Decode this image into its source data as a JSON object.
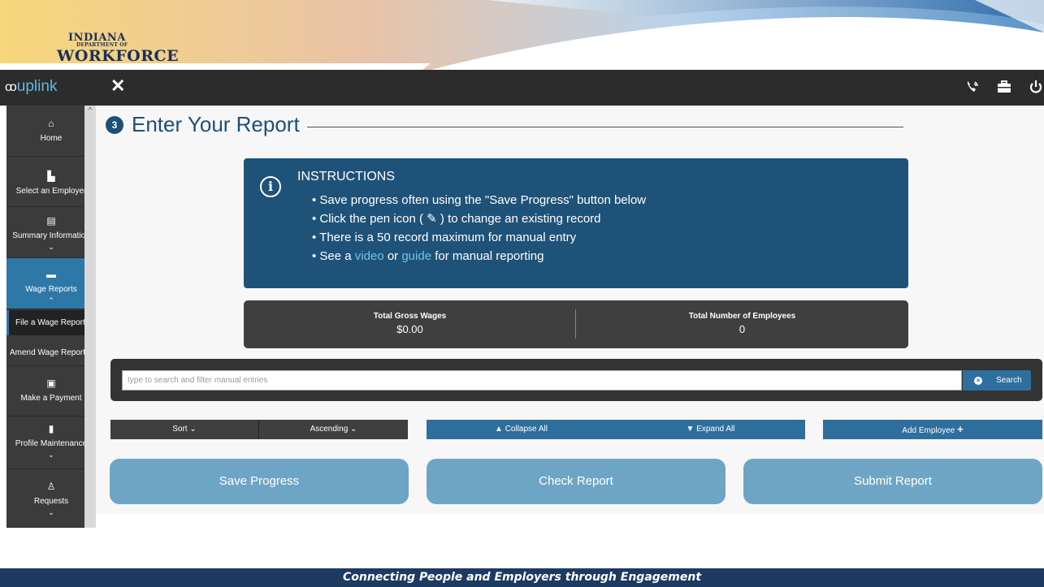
{
  "banner": {
    "logo_line1": "INDIANA",
    "logo_line2": "DEPARTMENT OF",
    "logo_line3": "WORKFORCE"
  },
  "topbar": {
    "brand_prefix": "uplink",
    "brand_icon": "oo",
    "close_icon": "close-icon",
    "icons": [
      "phone-ringing-icon",
      "briefcase-icon",
      "power-icon"
    ]
  },
  "sidebar": {
    "items": [
      {
        "label": "Home",
        "icon": "home-icon"
      },
      {
        "label": "Select an Employer",
        "icon": "building-icon"
      },
      {
        "label": "Summary Information",
        "icon": "document-icon"
      },
      {
        "label": "Wage Reports",
        "icon": "folder-icon"
      },
      {
        "label": "Make a Payment",
        "icon": "money-icon"
      },
      {
        "label": "Profile Maintenance",
        "icon": "file-icon"
      },
      {
        "label": "Requests",
        "icon": "user-icon"
      }
    ],
    "subitems": [
      "File a Wage Report",
      "Amend Wage Report"
    ]
  },
  "main": {
    "step_number": "3",
    "title": "Enter Your Report",
    "instructions": {
      "title": "INSTRUCTIONS",
      "line1": "Save progress often using the \"Save Progress\" button below",
      "line2_a": "Click the pen icon (",
      "line2_b": ") to change an existing record",
      "line3": "There is a 50 record maximum for manual entry",
      "line4_a": "See a",
      "line4_video": "video",
      "line4_or": "or",
      "line4_guide": "guide",
      "line4_b": "for manual reporting"
    },
    "totals": {
      "gross_label": "Total Gross Wages",
      "gross_value": "$0.00",
      "employees_label": "Total Number of Employees",
      "employees_value": "0"
    },
    "search": {
      "placeholder": "type to search and filter manual entries",
      "button": "Search"
    },
    "controls": {
      "sort": "Sort",
      "order": "Ascending",
      "collapse": "Collapse All",
      "expand": "Expand All",
      "add_employee": "Add Employee"
    },
    "actions": {
      "save": "Save Progress",
      "check": "Check Report",
      "submit": "Submit Report"
    }
  },
  "footer": {
    "tagline": "Connecting People and Employers through Engagement"
  },
  "colors": {
    "primary": "#1f5278",
    "accent_blue": "#2e6f9e",
    "link": "#6fc3ee",
    "dark_bar": "#2c2c2c",
    "footer": "#1d3a63"
  }
}
